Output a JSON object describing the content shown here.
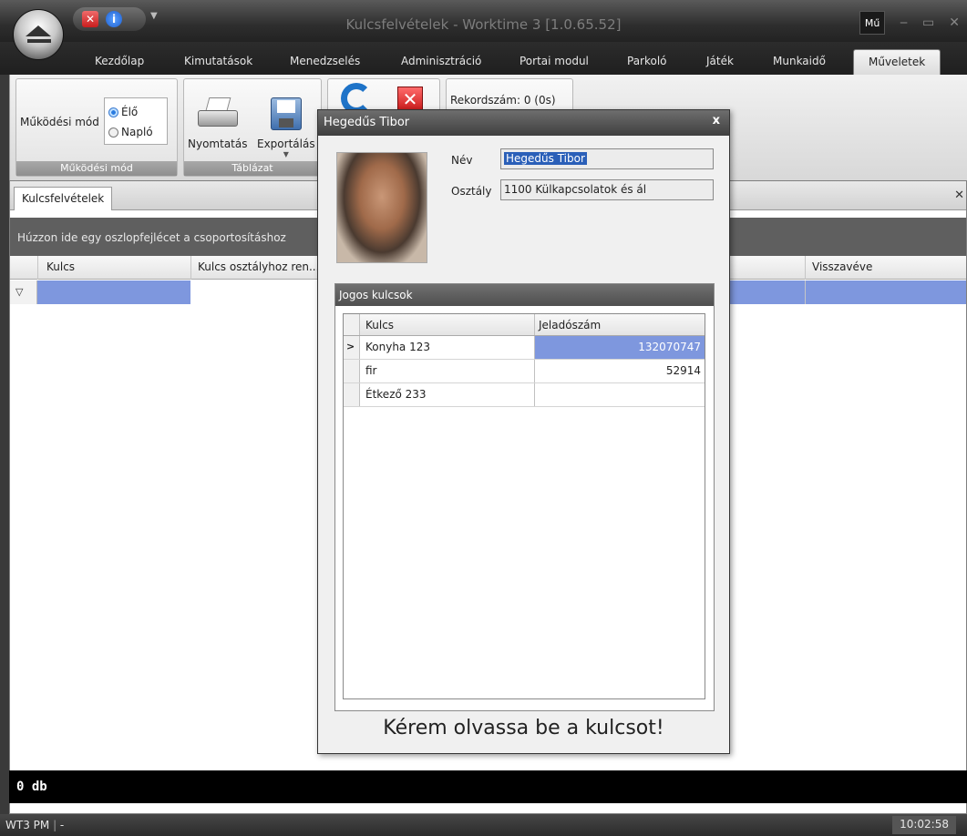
{
  "window": {
    "title": "Kulcsfelvételek - Worktime 3 [1.0.65.52]",
    "user_badge": "Mű"
  },
  "ribbon_tabs": [
    "Kezdőlap",
    "Kimutatások",
    "Menedzselés",
    "Adminisztráció",
    "Portai modul",
    "Parkoló",
    "Játék",
    "Munkaidő",
    "Műveletek"
  ],
  "active_tab": "Műveletek",
  "ribbon": {
    "mode_group": {
      "label": "Működési mód",
      "caption": "Működési mód",
      "options": [
        "Élő",
        "Napló"
      ],
      "selected": "Élő"
    },
    "table_group": {
      "label": "Táblázat",
      "print": "Nyomtatás",
      "export": "Exportálás"
    },
    "record_count": "Rekordszám: 0 (0s)"
  },
  "document": {
    "tab": "Kulcsfelvételek",
    "group_hint": "Húzzon ide egy oszlopfejlécet a csoportosításhoz",
    "columns": [
      "Kulcs",
      "Kulcs osztályhoz ren...",
      "Visszavéve"
    ],
    "footer": "0 db"
  },
  "dialog": {
    "title": "Hegedűs Tibor",
    "name_label": "Név",
    "name_value": "Hegedűs Tibor",
    "dept_label": "Osztály",
    "dept_value": "1100 Külkapcsolatok és ál",
    "section": "Jogos kulcsok",
    "grid_headers": [
      "Kulcs",
      "Jeladószám"
    ],
    "rows": [
      {
        "key": "Konyha 123",
        "code": "132070747"
      },
      {
        "key": "fir",
        "code": "52914"
      },
      {
        "key": "Étkező 233",
        "code": ""
      }
    ],
    "prompt": "Kérem olvassa be a kulcsot!"
  },
  "status": {
    "left": "WT3 PM",
    "sep": "-",
    "time": "10:02:58"
  },
  "colors": {
    "accent_blue": "#7e97de",
    "title_bar": "#2e2e2e"
  }
}
